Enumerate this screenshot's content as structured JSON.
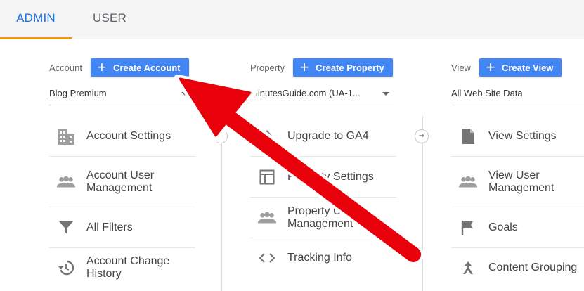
{
  "tabs": {
    "admin": "ADMIN",
    "user": "USER"
  },
  "account": {
    "label": "Account",
    "button": "Create Account",
    "selected": "Blog Premium",
    "items": [
      "Account Settings",
      "Account User Management",
      "All Filters",
      "Account Change History"
    ]
  },
  "property": {
    "label": "Property",
    "button": "Create Property",
    "selected": "MinutesGuide.com (UA-1...",
    "items": [
      "Upgrade to GA4",
      "Property Settings",
      "Property User Management",
      "Tracking Info"
    ]
  },
  "view": {
    "label": "View",
    "button": "Create View",
    "selected": "All Web Site Data",
    "items": [
      "View Settings",
      "View User Management",
      "Goals",
      "Content Grouping"
    ]
  },
  "colors": {
    "accent": "#4285f4",
    "tab_active": "#1a73e8",
    "tab_underline": "#f29900",
    "annotation_arrow": "#e8000b"
  }
}
